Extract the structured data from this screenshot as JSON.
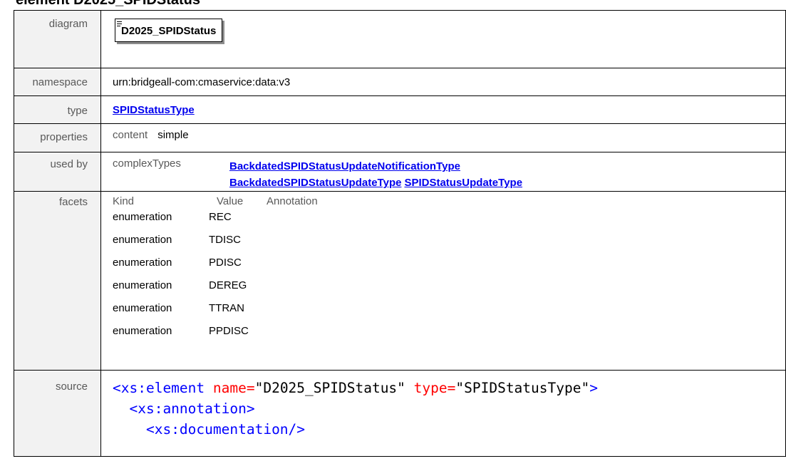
{
  "heading": "element D2025_SPIDStatus",
  "labels": {
    "diagram": "diagram",
    "namespace": "namespace",
    "type": "type",
    "properties": "properties",
    "used_by": "used by",
    "facets": "facets",
    "source": "source"
  },
  "diagram": {
    "element_name": "D2025_SPIDStatus",
    "icon": "documentation-lines-icon"
  },
  "namespace": "urn:bridgeall-com:cmaservice:data:v3",
  "type": {
    "link_text": "SPIDStatusType"
  },
  "properties": {
    "key": "content",
    "value": "simple"
  },
  "used_by": {
    "category": "complexTypes",
    "links": [
      "BackdatedSPIDStatusUpdateNotificationType",
      "BackdatedSPIDStatusUpdateType",
      "SPIDStatusUpdateType"
    ]
  },
  "facets": {
    "headers": [
      "Kind",
      "Value",
      "Annotation"
    ],
    "rows": [
      {
        "kind": "enumeration",
        "value": "REC"
      },
      {
        "kind": "enumeration",
        "value": "TDISC"
      },
      {
        "kind": "enumeration",
        "value": "PDISC"
      },
      {
        "kind": "enumeration",
        "value": "DEREG"
      },
      {
        "kind": "enumeration",
        "value": "TTRAN"
      },
      {
        "kind": "enumeration",
        "value": "PPDISC"
      }
    ]
  },
  "source": {
    "line1": {
      "open": "<xs:element",
      "attr1": "name=",
      "val1": "\"D2025_SPIDStatus\"",
      "attr2": "type=",
      "val2": "\"SPIDStatusType\"",
      "close": ">"
    },
    "line2": "<xs:annotation>",
    "line3": "<xs:documentation/>"
  },
  "colors": {
    "link": "#0000ee",
    "label_bg": "#f2f2f2",
    "xml_tag": "#0000ff",
    "xml_attr": "#ff0000"
  }
}
